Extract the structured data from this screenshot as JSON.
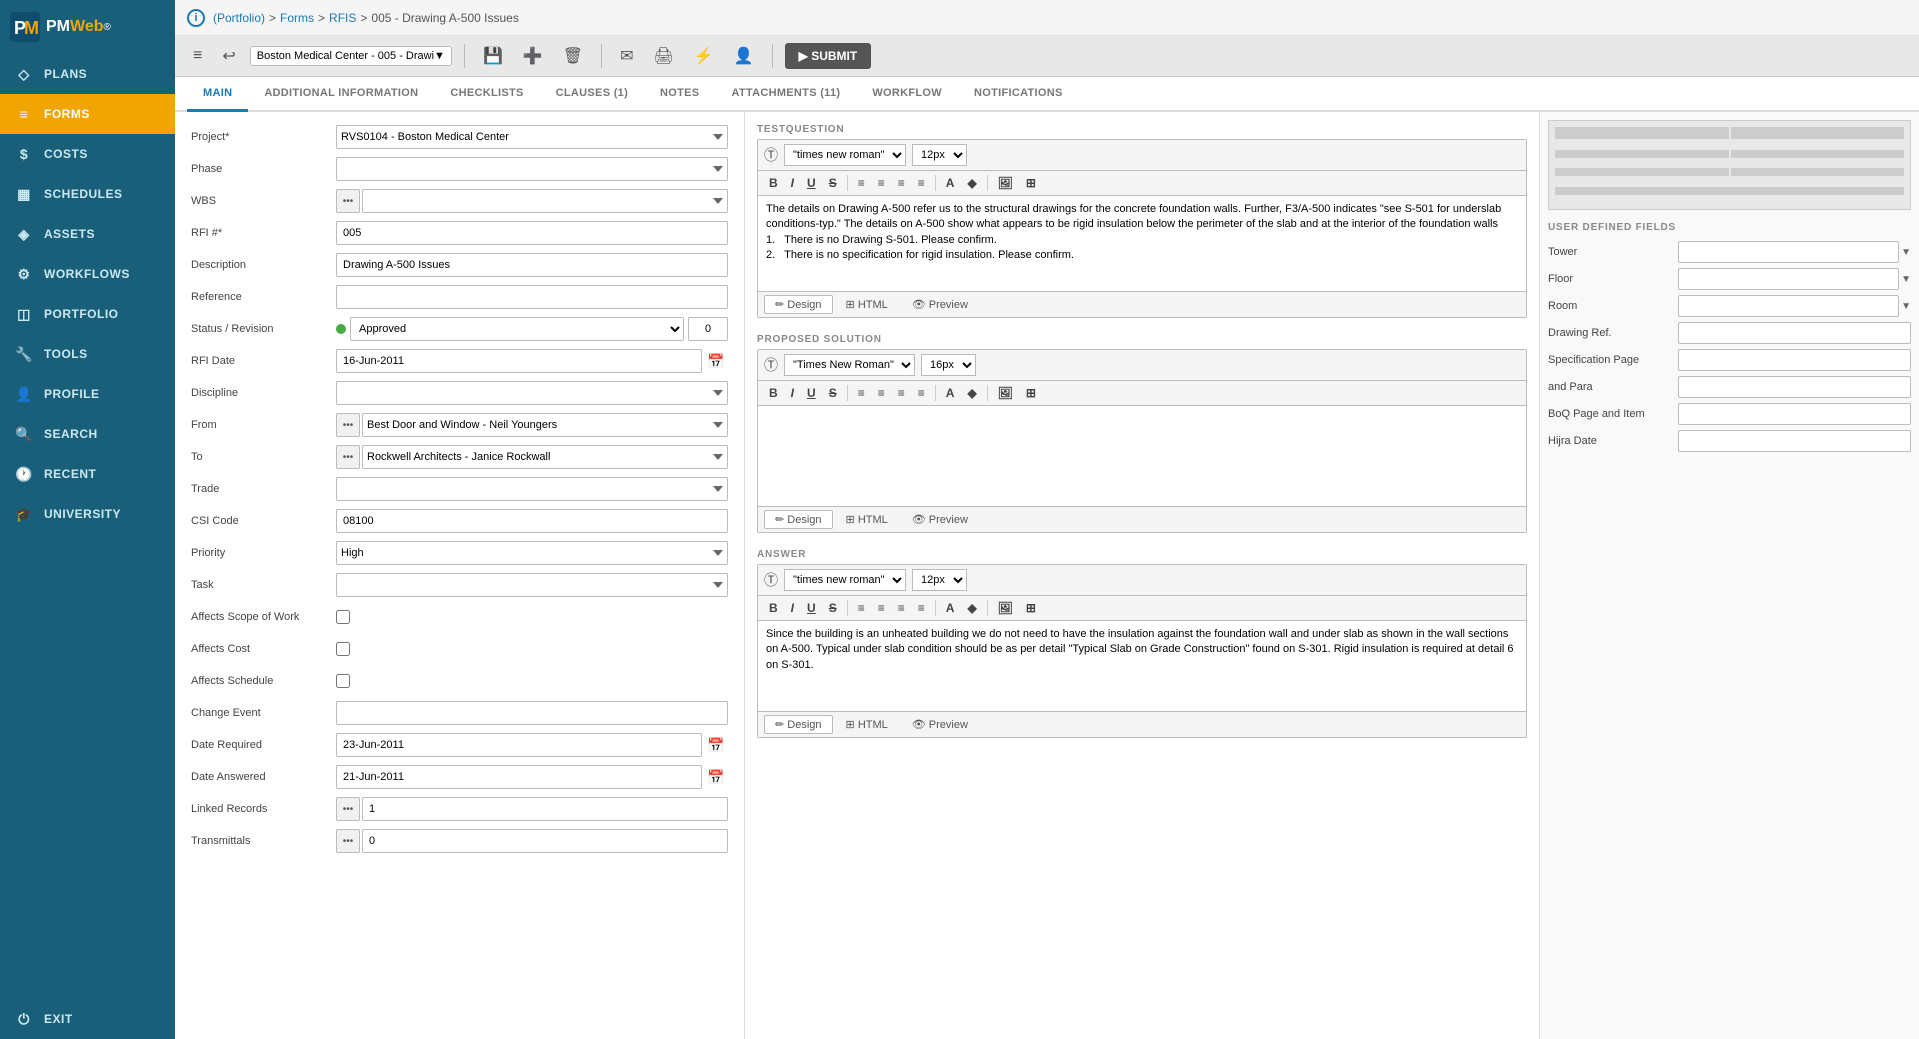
{
  "app": {
    "logo_pm": "<PM",
    "logo_web": "Web",
    "logo_r": "®"
  },
  "sidebar": {
    "items": [
      {
        "id": "plans",
        "label": "PLANS",
        "icon": "◇",
        "active": false
      },
      {
        "id": "forms",
        "label": "FORMS",
        "icon": "≡",
        "active": true
      },
      {
        "id": "costs",
        "label": "COSTS",
        "icon": "$",
        "active": false
      },
      {
        "id": "schedules",
        "label": "SCHEDULES",
        "icon": "📅",
        "active": false
      },
      {
        "id": "assets",
        "label": "ASSETS",
        "icon": "◈",
        "active": false
      },
      {
        "id": "workflows",
        "label": "WORKFLOWS",
        "icon": "⚙",
        "active": false
      },
      {
        "id": "portfolio",
        "label": "PORTFOLIO",
        "icon": "◫",
        "active": false
      },
      {
        "id": "tools",
        "label": "TOOLS",
        "icon": "🔧",
        "active": false
      },
      {
        "id": "profile",
        "label": "PROFILE",
        "icon": "👤",
        "active": false
      },
      {
        "id": "search",
        "label": "SEARCH",
        "icon": "🔍",
        "active": false
      },
      {
        "id": "recent",
        "label": "RECENT",
        "icon": "🕐",
        "active": false
      },
      {
        "id": "university",
        "label": "UNIVERSITY",
        "icon": "🎓",
        "active": false
      },
      {
        "id": "exit",
        "label": "EXIT",
        "icon": "⏻",
        "active": false
      }
    ]
  },
  "header": {
    "breadcrumb": "(Portfolio) > Forms > RFIS > 005 - Drawing A-500 Issues",
    "portfolio_link": "(Portfolio)",
    "forms_link": "Forms",
    "rfis_link": "RFIS",
    "current": "005 - Drawing A-500 Issues"
  },
  "toolbar": {
    "record_selector": "Boston Medical Center - 005 - Drawi",
    "submit_label": "▶ SUBMIT"
  },
  "tabs": [
    {
      "id": "main",
      "label": "MAIN",
      "active": true
    },
    {
      "id": "additional",
      "label": "ADDITIONAL INFORMATION",
      "active": false
    },
    {
      "id": "checklists",
      "label": "CHECKLISTS",
      "active": false
    },
    {
      "id": "clauses",
      "label": "CLAUSES (1)",
      "active": false
    },
    {
      "id": "notes",
      "label": "NOTES",
      "active": false
    },
    {
      "id": "attachments",
      "label": "ATTACHMENTS (11)",
      "active": false
    },
    {
      "id": "workflow",
      "label": "WORKFLOW",
      "active": false
    },
    {
      "id": "notifications",
      "label": "NOTIFICATIONS",
      "active": false
    }
  ],
  "form": {
    "project_label": "Project*",
    "project_value": "RVS0104 - Boston Medical Center",
    "phase_label": "Phase",
    "phase_value": "",
    "wbs_label": "WBS",
    "wbs_value": "",
    "rfi_num_label": "RFI #*",
    "rfi_num_value": "005",
    "description_label": "Description",
    "description_value": "Drawing A-500 Issues",
    "reference_label": "Reference",
    "reference_value": "",
    "status_label": "Status / Revision",
    "status_value": "Approved",
    "status_revision": "0",
    "rfi_date_label": "RFI Date",
    "rfi_date_value": "16-Jun-2011",
    "discipline_label": "Discipline",
    "discipline_value": "",
    "from_label": "From",
    "from_value": "Best Door and Window - Neil Youngers",
    "to_label": "To",
    "to_value": "Rockwell Architects - Janice Rockwall",
    "trade_label": "Trade",
    "trade_value": "",
    "csi_code_label": "CSI Code",
    "csi_code_value": "08100",
    "priority_label": "Priority",
    "priority_value": "High",
    "task_label": "Task",
    "task_value": "",
    "affects_scope_label": "Affects Scope of Work",
    "affects_cost_label": "Affects Cost",
    "affects_schedule_label": "Affects Schedule",
    "change_event_label": "Change Event",
    "change_event_value": "",
    "date_required_label": "Date Required",
    "date_required_value": "23-Jun-2011",
    "date_answered_label": "Date Answered",
    "date_answered_value": "21-Jun-2011",
    "linked_records_label": "Linked Records",
    "linked_records_value": "1",
    "transmittals_label": "Transmittals",
    "transmittals_value": "0"
  },
  "testquestion": {
    "section_label": "TESTQUESTION",
    "font": "\"times new roman\"",
    "size": "12px",
    "content": "The details on Drawing A-500 refer us to the structural drawings for the concrete foundation walls. Further, F3/A-500 indicates \"see S-501 for underslab conditions-typ.\" The details on A-500 show what appears to be rigid insulation below the perimeter of the slab and at the interior of the foundation walls\n1.   There is no Drawing S-501. Please confirm.\n2.   There is no specification for rigid insulation. Please confirm.",
    "tab_design": "Design",
    "tab_html": "HTML",
    "tab_preview": "Preview"
  },
  "proposed_solution": {
    "section_label": "PROPOSED SOLUTION",
    "font": "\"Times New Roman\"",
    "size": "16px",
    "content": "",
    "tab_design": "Design",
    "tab_html": "HTML",
    "tab_preview": "Preview"
  },
  "answer": {
    "section_label": "ANSWER",
    "font": "\"times new roman\"",
    "size": "12px",
    "content": "Since the building is an unheated building we do not need to have the insulation against the foundation wall and under slab as shown in the wall sections on A-500. Typical under slab condition should be as per detail \"Typical Slab on Grade Construction\" found on S-301. Rigid insulation is required at detail 6 on S-301.",
    "tab_design": "Design",
    "tab_html": "HTML",
    "tab_preview": "Preview"
  },
  "udf": {
    "section_label": "USER DEFINED FIELDS",
    "fields": [
      {
        "label": "Tower",
        "value": "",
        "type": "select"
      },
      {
        "label": "Floor",
        "value": "",
        "type": "select"
      },
      {
        "label": "Room",
        "value": "",
        "type": "select"
      },
      {
        "label": "Drawing Ref.",
        "value": "",
        "type": "text"
      },
      {
        "label": "Specification Page",
        "value": "",
        "type": "text"
      },
      {
        "label": "and Para",
        "value": "",
        "type": "text"
      },
      {
        "label": "BoQ Page and Item",
        "value": "",
        "type": "text"
      },
      {
        "label": "Hijra Date",
        "value": "",
        "type": "text"
      }
    ]
  }
}
